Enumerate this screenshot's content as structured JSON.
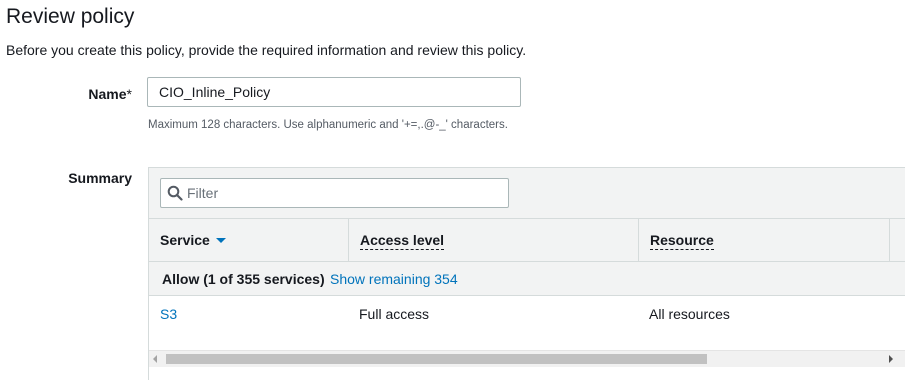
{
  "page": {
    "title": "Review policy",
    "description": "Before you create this policy, provide the required information and review this policy."
  },
  "name_field": {
    "label": "Name",
    "required_mark": "*",
    "value": "CIO_Inline_Policy",
    "hint": "Maximum 128 characters. Use alphanumeric and '+=,.@-_' characters."
  },
  "summary": {
    "label": "Summary",
    "filter": {
      "placeholder": "Filter",
      "icon": "search-icon"
    },
    "columns": [
      {
        "label": "Service",
        "sort": "descending"
      },
      {
        "label": "Access level"
      },
      {
        "label": "Resource"
      }
    ],
    "group": {
      "label": "Allow (1 of 355 services)",
      "link": "Show remaining 354"
    },
    "rows": [
      {
        "service": "S3",
        "access_level": "Full access",
        "resource": "All resources"
      }
    ]
  },
  "colors": {
    "link": "#0073bb",
    "header_bg": "#f2f3f3",
    "border": "#d5dbdb"
  }
}
